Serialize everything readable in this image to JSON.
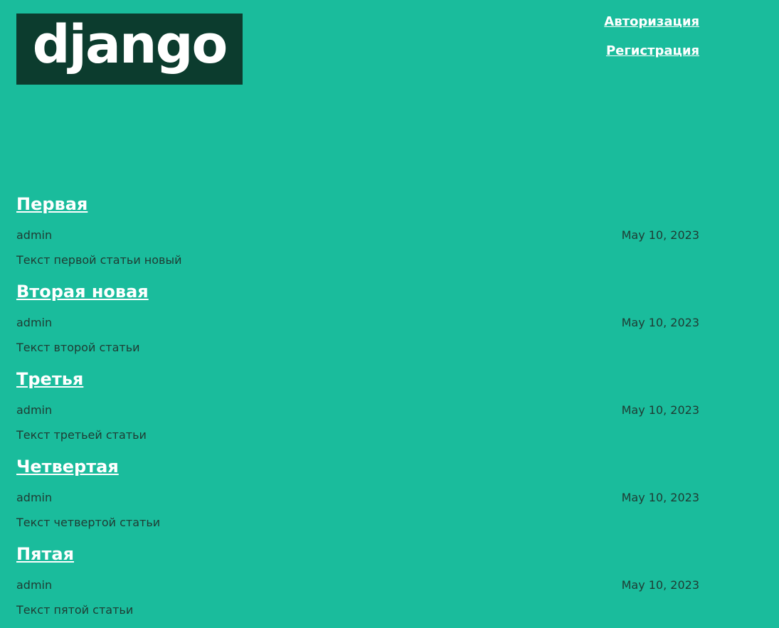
{
  "header": {
    "logo_text": "django",
    "nav": [
      {
        "label": "Авторизация"
      },
      {
        "label": "Регистрация"
      }
    ]
  },
  "posts": [
    {
      "title": "Первая",
      "author": "admin",
      "date": "May 10, 2023",
      "text": "Текст первой статьи новый"
    },
    {
      "title": "Вторая новая",
      "author": "admin",
      "date": "May 10, 2023",
      "text": "Текст второй статьи"
    },
    {
      "title": "Третья",
      "author": "admin",
      "date": "May 10, 2023",
      "text": "Текст третьей статьи"
    },
    {
      "title": "Четвертая",
      "author": "admin",
      "date": "May 10, 2023",
      "text": "Текст четвертой статьи"
    },
    {
      "title": "Пятая",
      "author": "admin",
      "date": "May 10, 2023",
      "text": "Текст пятой статьи"
    }
  ],
  "colors": {
    "background": "#1abc9c",
    "logo_background": "#0c3c2e",
    "link": "#ffffff",
    "text": "#1f3b33"
  }
}
